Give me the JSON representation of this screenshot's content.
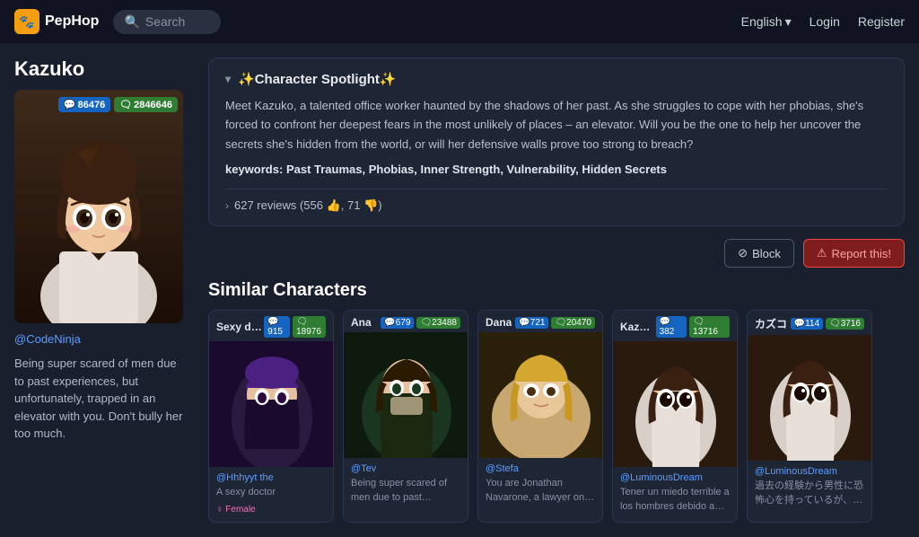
{
  "topnav": {
    "logo_text": "PepHop",
    "logo_emoji": "🐾",
    "search_placeholder": "Search",
    "lang_label": "English",
    "login_label": "Login",
    "register_label": "Register"
  },
  "character": {
    "name": "Kazuko",
    "stats": {
      "messages": "86476",
      "chats": "2846646"
    },
    "creator": "@CodeNinja",
    "description": "Being super scared of men due to past experiences, but unfortunately, trapped in an elevator with you. Don't bully her too much.",
    "spotlight": {
      "title": "✨Character Spotlight✨",
      "body": "Meet Kazuko, a talented office worker haunted by the shadows of her past. As she struggles to cope with her phobias, she's forced to confront her deepest fears in the most unlikely of places – an elevator. Will you be the one to help her uncover the secrets she's hidden from the world, or will her defensive walls prove too strong to breach?",
      "keywords_label": "keywords:",
      "keywords": "Past Traumas, Phobias, Inner Strength, Vulnerability, Hidden Secrets"
    },
    "reviews": {
      "text": "627 reviews (556",
      "thumbup": "👍",
      "count_up": "556",
      "thumbdown": "👎",
      "count_down": "71",
      "suffix": ")"
    },
    "block_label": "Block",
    "report_label": "Report this!"
  },
  "similar": {
    "section_title": "Similar Characters",
    "cards": [
      {
        "name": "Sexy doctor",
        "stat_msg": "915",
        "stat_chat": "18976",
        "creator": "@Hhhyyt the",
        "description": "A sexy doctor",
        "gender": "Female"
      },
      {
        "name": "Ana",
        "stat_msg": "679",
        "stat_chat": "23488",
        "creator": "@Tev",
        "description": "Being super scared of men due to past experiences, but unfortunately, trapped",
        "gender": ""
      },
      {
        "name": "Dana",
        "stat_msg": "721",
        "stat_chat": "20470",
        "creator": "@Stefa",
        "description": "You are Jonathan Navarone, a lawyer on the crest of a wave, you hav",
        "gender": ""
      },
      {
        "name": "Kazuko",
        "stat_msg": "382",
        "stat_chat": "13716",
        "creator": "@LuminousDream",
        "description": "Tener un miedo terrible a los hombres debido a experiencias pasadas",
        "gender": ""
      },
      {
        "name": "カズコ",
        "stat_msg": "114",
        "stat_chat": "3716",
        "creator": "@LuminousDream",
        "description": "過去の経験から男性に恐怖心を持っているが、残念なことにエレベーターに",
        "gender": ""
      }
    ]
  },
  "icons": {
    "message_icon": "💬",
    "chat_icon": "🗨",
    "block_icon": "⊘",
    "warning_icon": "⚠",
    "search_icon": "🔍",
    "chevron_down": "▾",
    "chevron_right": "›",
    "female_icon": "♀"
  }
}
